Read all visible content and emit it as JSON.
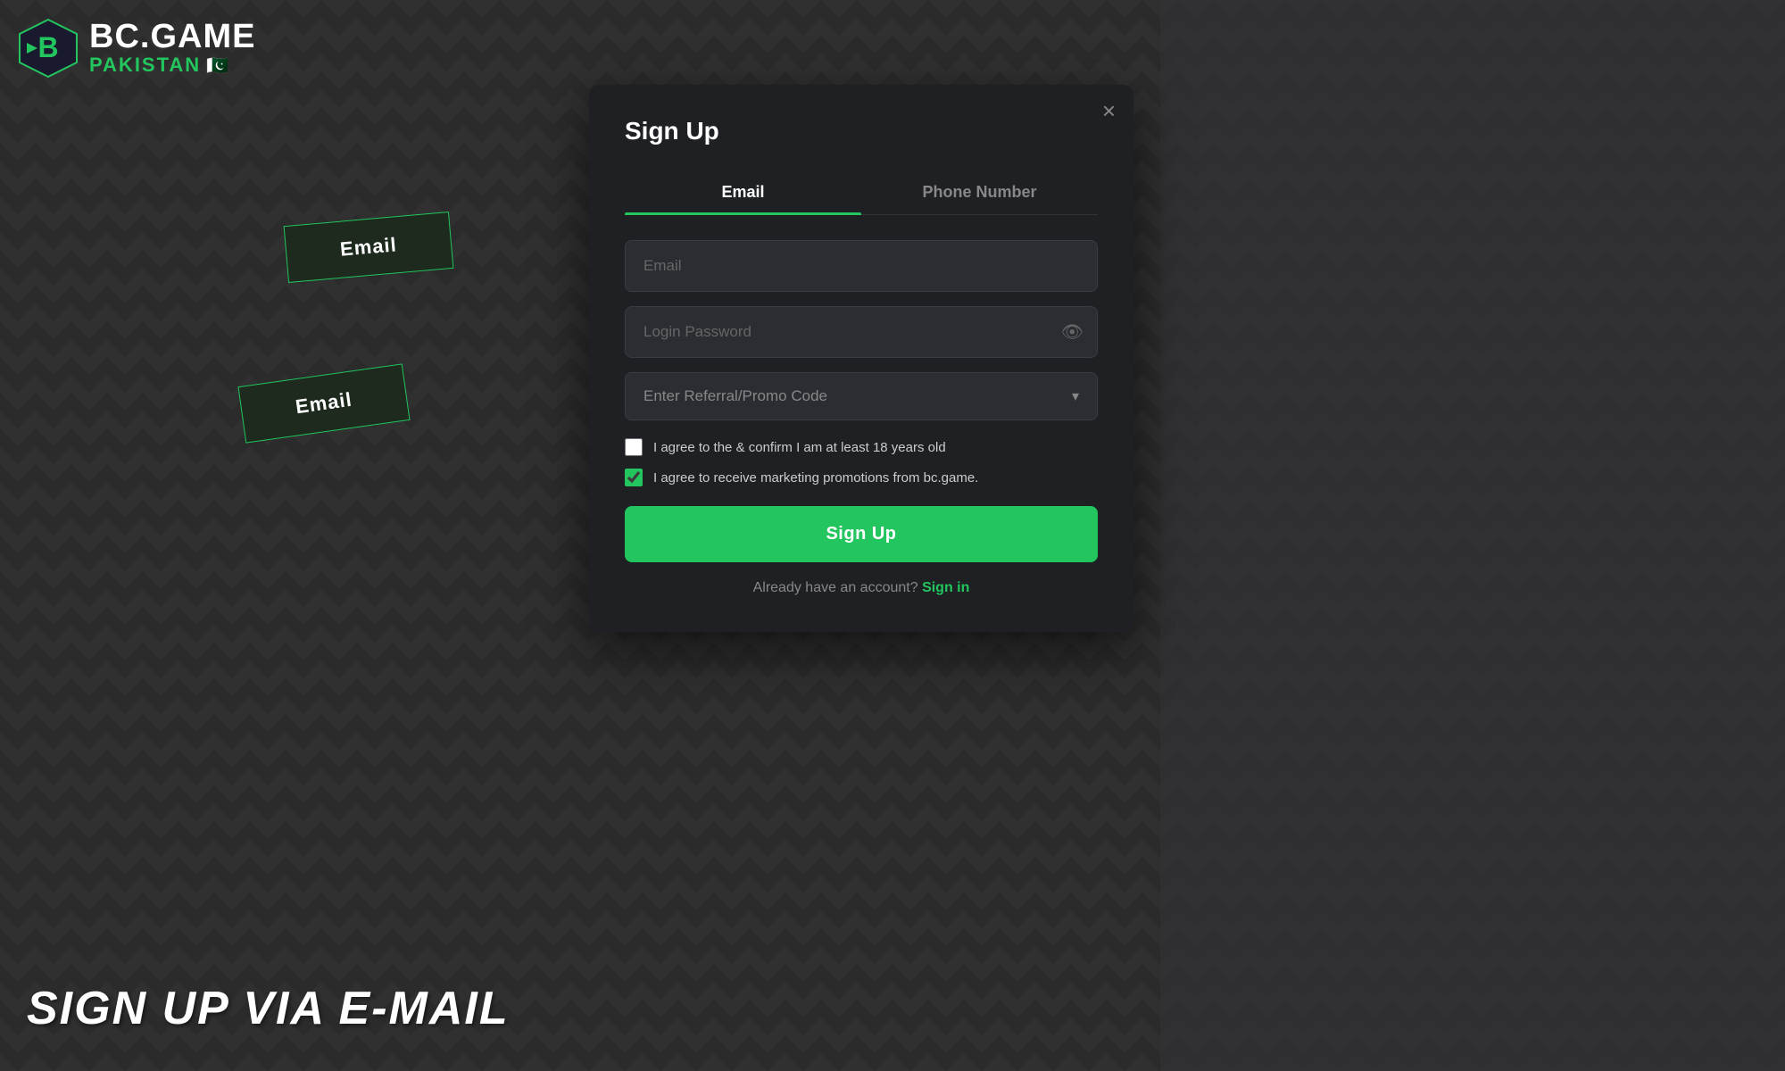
{
  "brand": {
    "name": "BC.GAME",
    "subtitle": "PAKISTAN",
    "flag_emoji": "🇵🇰"
  },
  "background": {
    "color": "#2a2a2a"
  },
  "floating_buttons": [
    {
      "label": "Email"
    },
    {
      "label": "Email"
    }
  ],
  "bottom_hero_text": "SIGN UP VIA E-MAIL",
  "modal": {
    "title": "Sign Up",
    "close_label": "×",
    "tabs": [
      {
        "id": "email",
        "label": "Email",
        "active": true
      },
      {
        "id": "phone",
        "label": "Phone Number",
        "active": false
      }
    ],
    "fields": {
      "email_placeholder": "Email",
      "password_placeholder": "Login Password"
    },
    "promo": {
      "label": "Enter Referral/Promo Code",
      "chevron": "▾"
    },
    "checkboxes": [
      {
        "id": "age_confirm",
        "label": "I agree to the & confirm I am at least 18 years old",
        "checked": false
      },
      {
        "id": "marketing",
        "label": "I agree to receive marketing promotions from bc.game.",
        "checked": true
      }
    ],
    "signup_button": "Sign Up",
    "signin_prompt": "Already have an account?",
    "signin_link": "Sign in"
  }
}
